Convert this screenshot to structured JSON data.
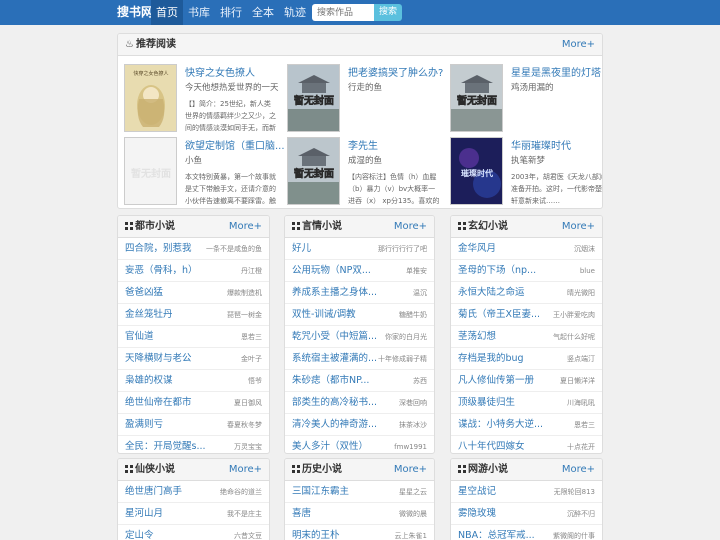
{
  "nav": {
    "brand": "搜书网",
    "items": [
      "首页",
      "书库",
      "排行",
      "全本",
      "轨迹"
    ],
    "search_placeholder": "搜索作品",
    "search_button": "搜索"
  },
  "recommend": {
    "title": "推荐阅读",
    "more": "More+",
    "items": [
      {
        "title": "快穿之女色撩人",
        "author": "今天他想热爱世界的一天",
        "desc": "【】简介：25世纪，新人类世界的情感羁绊少之又少，之间的情感淡漠如同手无，而新人类",
        "cover_text": "快穿之女色撩人"
      },
      {
        "title": "把老婆搞哭了肿么办?",
        "author": "行走的鱼",
        "desc": "",
        "cover_text": "暂无封面"
      },
      {
        "title": "星星是黑夜里的灯塔",
        "author": "鸡汤用漏的",
        "desc": "",
        "cover_text": "暂无封面"
      },
      {
        "title": "欲望定制馆（重口脑...",
        "author": "小鱼",
        "desc": "本文特别黄暴，第一个故事就是丈下带触手文，还请介意的小伙伴告速撤离不要踩雷。触",
        "cover_text": "暂无封面"
      },
      {
        "title": "李先生",
        "author": "成湿的鱼",
        "desc": "【内容标注】色情（h）血腥（b）暴力（v）bv大概率一进吞（x） xp分135。喜欢的xp",
        "cover_text": "暂无封面"
      },
      {
        "title": "华丽璀璨时代",
        "author": "执笔新梦",
        "desc": "2003年，胡君医《天龙八部》准备开拍。这时，一代影帝楚轩意新来试……",
        "cover_text": "璀璨时代"
      }
    ]
  },
  "lists": [
    {
      "title": "都市小说",
      "more": "More+",
      "rows": [
        {
          "title": "四合院，别惹我",
          "author": "一条不是咸鱼的鱼"
        },
        {
          "title": "妄恶（骨科，h）",
          "author": "丹江橙"
        },
        {
          "title": "爸爸凶猛",
          "author": "爆款制造机"
        },
        {
          "title": "金丝笼牡丹",
          "author": "琵琶一树金"
        },
        {
          "title": "官仙道",
          "author": "恩若三"
        },
        {
          "title": "天降横财与老公",
          "author": "金叶子"
        },
        {
          "title": "枭雄的权谋",
          "author": "悟爷"
        },
        {
          "title": "绝世仙帝在都市",
          "author": "夏日御风"
        },
        {
          "title": "盈满则亏",
          "author": "春夏秋冬梦"
        },
        {
          "title": "全民：开局觉醒s...",
          "author": "万灵宝宝"
        }
      ]
    },
    {
      "title": "言情小说",
      "more": "More+",
      "rows": [
        {
          "title": "好儿",
          "author": "那行行行行了吧"
        },
        {
          "title": "公用玩物（NP双...",
          "author": "单推安"
        },
        {
          "title": "养成系主播之身体...",
          "author": "温沉"
        },
        {
          "title": "双性-训诫/调教",
          "author": "糖醋牛奶"
        },
        {
          "title": "乾咒小受（中短篇...",
          "author": "你家的白月光"
        },
        {
          "title": "系统宿主被灌满的...",
          "author": "十年修成弱子精"
        },
        {
          "title": "朱砂痣（都市NP...",
          "author": "苏西"
        },
        {
          "title": "部类生的高冷秘书...",
          "author": "深巷回响"
        },
        {
          "title": "清冷美人的神奇游...",
          "author": "抹茶冰沙"
        },
        {
          "title": "美人多汁（双性）",
          "author": "fmw1991"
        }
      ]
    },
    {
      "title": "玄幻小说",
      "more": "More+",
      "rows": [
        {
          "title": "金华风月",
          "author": "沉烟沫"
        },
        {
          "title": "圣母的下场（np...",
          "author": "blue"
        },
        {
          "title": "永恒大陆之命运",
          "author": "晴光微阳"
        },
        {
          "title": "菊氏（帝王X臣妻...",
          "author": "王小胖爱吃肉"
        },
        {
          "title": "茎荡幻想",
          "author": "气起什么好呢"
        },
        {
          "title": "存档是我的bug",
          "author": "竖点端汀"
        },
        {
          "title": "凡人修仙传第一册",
          "author": "夏日懒洋洋"
        },
        {
          "title": "顶级暴徒归生",
          "author": "川海吼吼"
        },
        {
          "title": "谍战：小特务大逆...",
          "author": "恩若三"
        },
        {
          "title": "八十年代四嫁女",
          "author": "十点花开"
        }
      ]
    },
    {
      "title": "仙侠小说",
      "more": "More+",
      "rows": [
        {
          "title": "绝世唐门高手",
          "author": "绝命谷的道兰"
        },
        {
          "title": "星河山月",
          "author": "我不是庄主"
        },
        {
          "title": "定山令",
          "author": "六昔文豆"
        }
      ]
    },
    {
      "title": "历史小说",
      "more": "More+",
      "rows": [
        {
          "title": "三国江东霸主",
          "author": "星星之云"
        },
        {
          "title": "喜唐",
          "author": "微微的晨"
        },
        {
          "title": "明末的王朴",
          "author": "云上朱雀1"
        }
      ]
    },
    {
      "title": "网游小说",
      "more": "More+",
      "rows": [
        {
          "title": "星空战记",
          "author": "无限轮回813"
        },
        {
          "title": "雾隐玫瑰",
          "author": "沉醉不归"
        },
        {
          "title": "NBA：总冠军戒...",
          "author": "紫微阁的什事"
        }
      ]
    }
  ]
}
